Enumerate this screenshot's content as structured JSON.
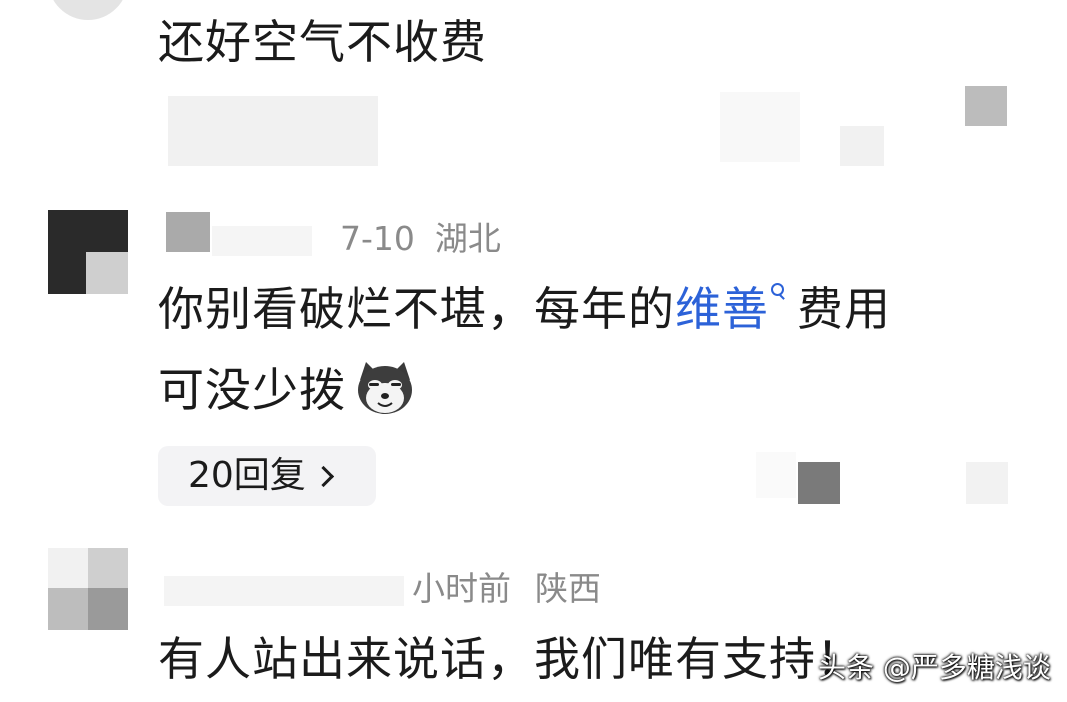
{
  "comments": [
    {
      "text": "还好空气不收费"
    },
    {
      "date": "7-10",
      "region": "湖北",
      "text_before_link": "你别看破烂不堪，每年的",
      "link_text": "维善",
      "text_after_link": "费用",
      "text_line2": "可没少拨",
      "emoji": "dog-face-emoji",
      "replies_label": "20回复"
    },
    {
      "time": "小时前",
      "region": "陕西",
      "text": "有人站出来说话，我们唯有支持！"
    }
  ],
  "watermark": "头条 @严多糖浅谈",
  "colors": {
    "link": "#2c62d8",
    "meta": "#8a8a8a",
    "text": "#1b1b1b"
  }
}
